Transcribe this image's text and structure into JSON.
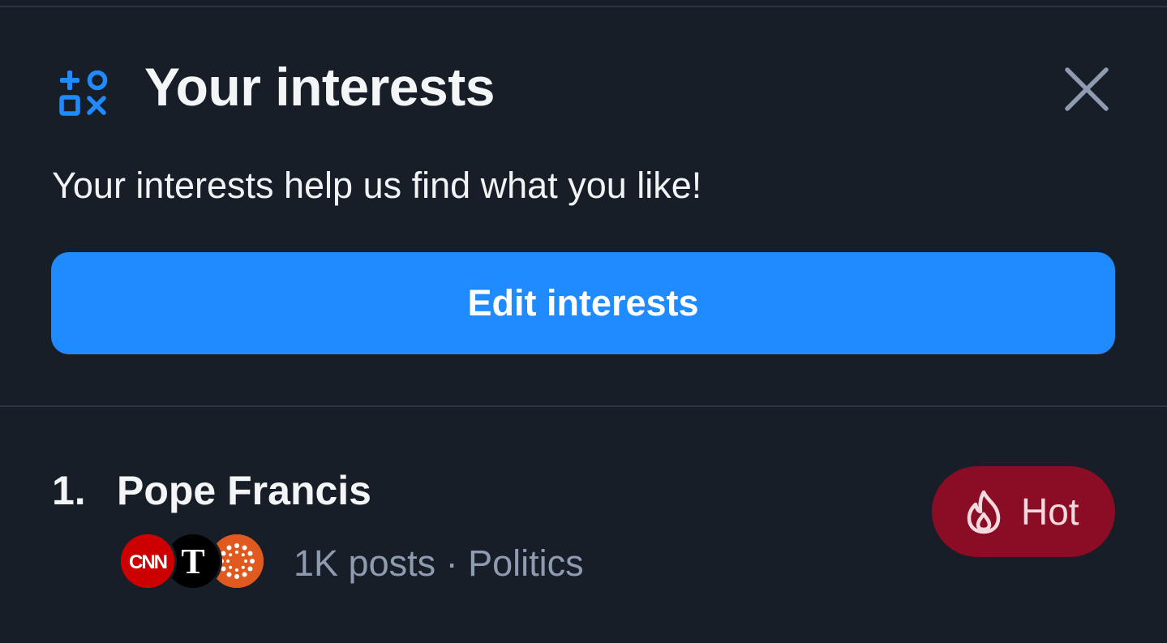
{
  "header": {
    "title": "Your interests",
    "icon": "shapes-icon",
    "close_icon": "close-icon"
  },
  "subtitle": "Your interests help us find what you like!",
  "edit_button": {
    "label": "Edit interests"
  },
  "trends": [
    {
      "rank": "1.",
      "topic": "Pope Francis",
      "meta": "1K posts · Politics",
      "avatars": [
        {
          "name": "CNN",
          "icon": "cnn-logo",
          "color": "#cc0000"
        },
        {
          "name": "The New York Times",
          "icon": "nyt-logo",
          "color": "#000000"
        },
        {
          "name": "Reuters",
          "icon": "reuters-logo",
          "color": "#e05a1f"
        }
      ],
      "badge": {
        "label": "Hot",
        "icon": "flame-icon",
        "color": "#8a0d25"
      }
    }
  ],
  "colors": {
    "background": "#171e27",
    "accent": "#208bfe",
    "divider": "#2b3644",
    "muted_text": "#8e9bb0"
  }
}
